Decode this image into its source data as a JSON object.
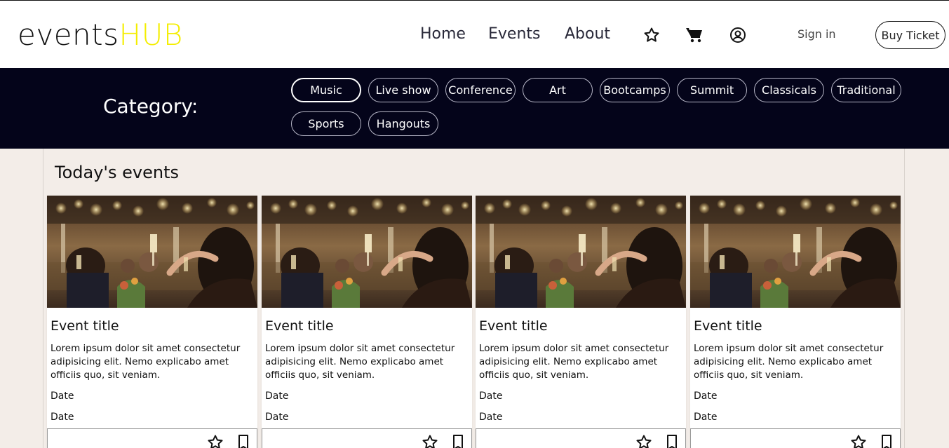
{
  "brand": {
    "text_main": "events",
    "text_accent": "HUB",
    "accent_color": "#f4ee00"
  },
  "nav": {
    "items": [
      "Home",
      "Events",
      "About"
    ]
  },
  "header_icons": [
    "star-icon",
    "cart-icon",
    "user-circle-icon"
  ],
  "auth": {
    "signin_label": "Sign in",
    "buy_label": "Buy Ticket"
  },
  "category": {
    "label": "Category:",
    "chips": [
      "Music",
      "Live show",
      "Conference",
      "Art",
      "Bootcamps",
      "Summit",
      "Classicals",
      "Traditional",
      "Sports",
      "Hangouts"
    ],
    "active": "Music"
  },
  "section": {
    "title": "Today's events"
  },
  "events": [
    {
      "title": "Event title",
      "desc": "Lorem ipsum dolor sit amet consectetur adipisicing elit. Nemo explicabo amet officiis quo, sit veniam.",
      "date1": "Date",
      "date2": "Date"
    },
    {
      "title": "Event title",
      "desc": "Lorem ipsum dolor sit amet consectetur adipisicing elit. Nemo explicabo amet officiis quo, sit veniam.",
      "date1": "Date",
      "date2": "Date"
    },
    {
      "title": "Event title",
      "desc": "Lorem ipsum dolor sit amet consectetur adipisicing elit. Nemo explicabo amet officiis quo, sit veniam.",
      "date1": "Date",
      "date2": "Date"
    },
    {
      "title": "Event title",
      "desc": "Lorem ipsum dolor sit amet consectetur adipisicing elit. Nemo explicabo amet officiis quo, sit veniam.",
      "date1": "Date",
      "date2": "Date"
    }
  ],
  "colors": {
    "category_bg": "#04041a",
    "page_bg": "#f3ede8"
  }
}
